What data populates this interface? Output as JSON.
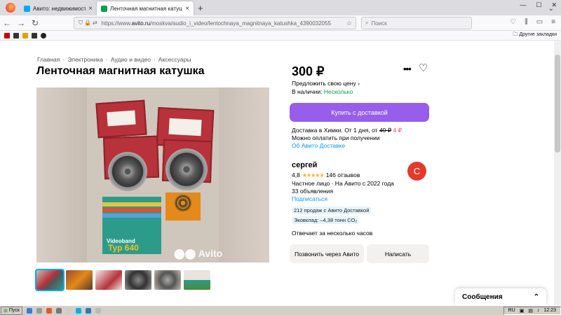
{
  "browser": {
    "tabs": [
      {
        "title": "Авито: недвижимость, транспо",
        "active": false
      },
      {
        "title": "Ленточная магнитная катушка",
        "active": true
      }
    ],
    "url_prefix": "https://www.",
    "url_domain": "avito.ru",
    "url_path": "/moskva/audio_i_video/lentochnaya_magnitnaya_katushka_4390032055",
    "search_placeholder": "Поиск",
    "other_bookmarks": "Другие закладки"
  },
  "breadcrumb": [
    "Главная",
    "Электроника",
    "Аудио и видео",
    "Аксессуары"
  ],
  "listing": {
    "title": "Ленточная магнитная катушка",
    "price": "300 ₽",
    "offer_price": "Предложить свою цену",
    "stock_label": "В наличии:",
    "stock_value": "Несколько",
    "buy_button": "Купить с доставкой",
    "delivery_text": "Доставка в Химки. От 1 дня, от",
    "delivery_old_price": "49 ₽",
    "delivery_new_price": "4 ₽",
    "pay_on_receipt": "Можно оплатить при получении",
    "about_delivery": "Об Авито Доставке",
    "photo_watermark": "Avito",
    "tape_brand": "Videoband",
    "tape_type": "Typ 640"
  },
  "seller": {
    "name": "сергей",
    "rating": "4,8",
    "stars": "★★★★★",
    "reviews": "146 отзывов",
    "type": "Частное лицо · На Авито с 2022 года",
    "ads": "33 объявления",
    "subscribe": "Подписаться",
    "avatar_letter": "С",
    "badge_sales": "212 продаж с Авито Доставкой",
    "badge_eco": "Эковклад: –4,38 тонн CO₂",
    "reply_time": "Отвечает за несколько часов",
    "call_button": "Позвонить через Авито",
    "message_button": "Написать"
  },
  "messages_panel": {
    "label": "Сообщения"
  },
  "taskbar": {
    "start": "Пуск",
    "lang": "RU",
    "clock": "12:23"
  },
  "colors": {
    "buy_button": "#965eeb",
    "link": "#0099f7",
    "stock_green": "#02a34a",
    "price_red": "#ff4053",
    "avatar": "#e4392c"
  }
}
